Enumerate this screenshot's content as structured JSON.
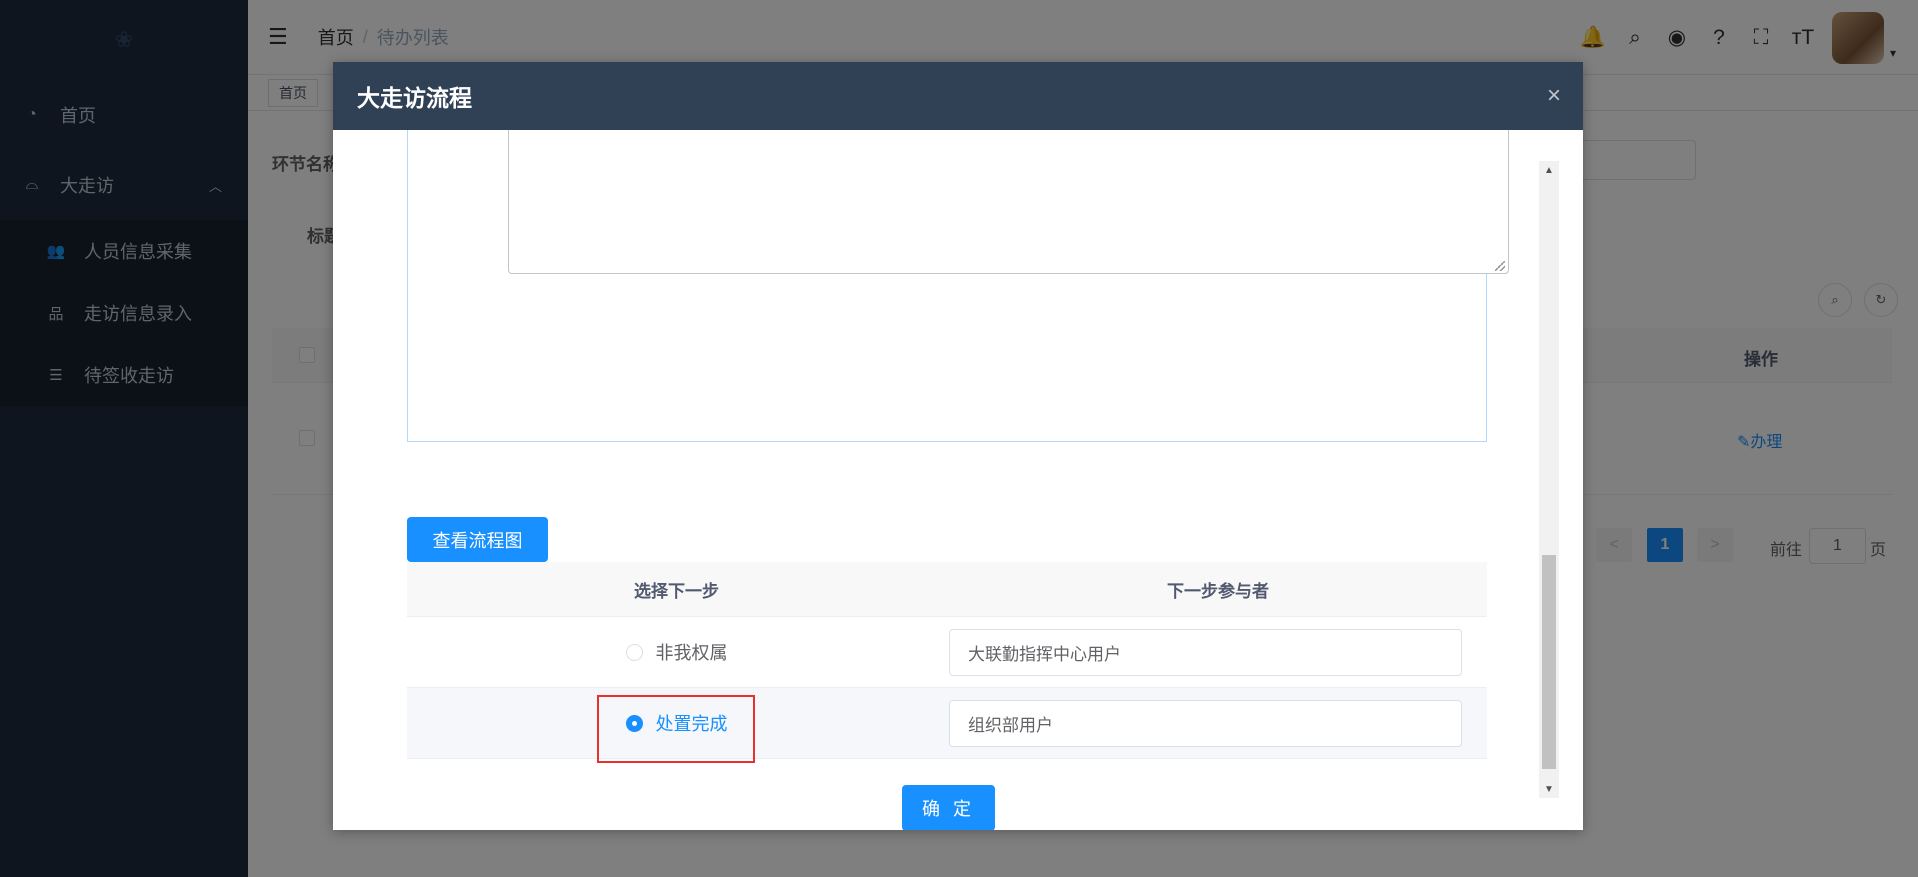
{
  "sidebar": {
    "logo": "❀",
    "items": [
      {
        "icon": "dashboard-icon",
        "glyph": "◔",
        "label": "首页"
      },
      {
        "icon": "visit-icon",
        "glyph": "⌓",
        "label": "大走访",
        "caret": "︿"
      }
    ],
    "subitems": [
      {
        "icon": "people-icon",
        "glyph": "👥",
        "label": "人员信息采集"
      },
      {
        "icon": "tree-icon",
        "glyph": "品",
        "label": "走访信息录入"
      },
      {
        "icon": "list-icon",
        "glyph": "☰",
        "label": "待签收走访"
      }
    ]
  },
  "navbar": {
    "hamburger": "☰",
    "breadcrumb": [
      "首页",
      "待办列表"
    ],
    "separator": "/",
    "icons": {
      "bell": "🔔",
      "search": "⌕",
      "github": "◉",
      "help": "?",
      "fullscreen": "⛶",
      "font_size": "ᴛT"
    },
    "avatar_caret": "▾"
  },
  "tagsview": {
    "tags": [
      "首页"
    ]
  },
  "background": {
    "label_stage": "环节名称",
    "label_title": "标题",
    "col_action": "操作",
    "row_action": "✎办理",
    "search_circle": "⌕",
    "refresh_circle": "↻",
    "pager": {
      "prev": "<",
      "current": "1",
      "next": ">",
      "goto_label": "前往",
      "goto_value": "1",
      "page_suffix": "页"
    }
  },
  "dialog": {
    "title": "大走访流程",
    "close": "×",
    "flow_button": "查看流程图",
    "table_headers": [
      "选择下一步",
      "下一步参与者"
    ],
    "rows": [
      {
        "option": "非我权属",
        "checked": false,
        "participant": "大联勤指挥中心用户"
      },
      {
        "option": "处置完成",
        "checked": true,
        "participant": "组织部用户"
      }
    ],
    "confirm_button": "确 定",
    "scroll_up": "▲",
    "scroll_down": "▼"
  },
  "colors": {
    "sidebar_bg": "#1f2a3c",
    "header_bg": "#304156",
    "primary": "#1890ff",
    "highlight": "#e8312f"
  }
}
